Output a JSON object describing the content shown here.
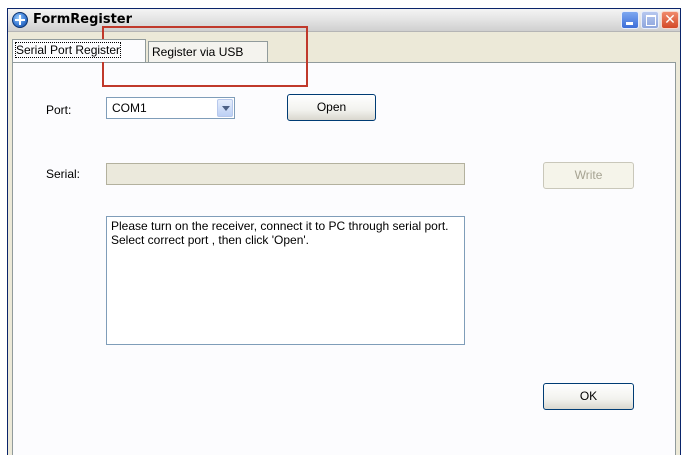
{
  "window": {
    "title": "FormRegister",
    "icon": "app-globe-icon"
  },
  "title_buttons": {
    "minimize": "minimize-icon",
    "maximize": "maximize-icon",
    "close": "close-icon",
    "close_glyph": "✕"
  },
  "tabs": [
    {
      "label": "Serial Port Register",
      "active": true
    },
    {
      "label": "Register via USB",
      "active": false
    }
  ],
  "form": {
    "port_label": "Port:",
    "port_value": "COM1",
    "open_label": "Open",
    "serial_label": "Serial:",
    "serial_value": "",
    "write_label": "Write",
    "message": "Please turn on the receiver, connect it to PC through serial port. Select correct port , then click 'Open'.",
    "ok_label": "OK"
  },
  "annotation": {
    "color": "#c0392b"
  }
}
